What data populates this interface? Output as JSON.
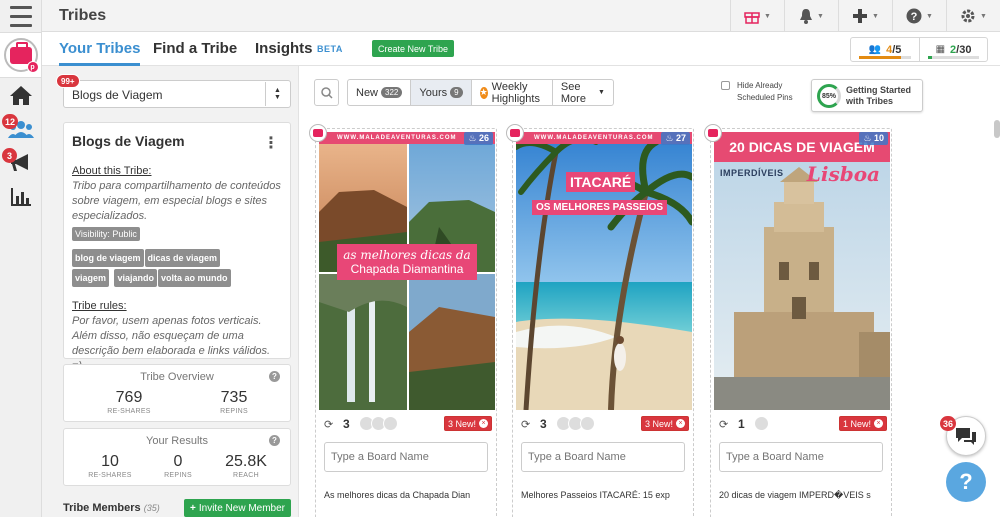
{
  "app": {
    "title": "Tribes",
    "colors": {
      "accent": "#3b8fd0",
      "brand": "#e5245e",
      "green": "#2ea44f",
      "badge": "#d9363e"
    }
  },
  "rail": {
    "logo_icon": "tailwind-logo-icon",
    "items": [
      {
        "icon": "home-icon"
      },
      {
        "icon": "tribes-icon",
        "badge": "12"
      },
      {
        "icon": "megaphone-icon",
        "badge": "3"
      },
      {
        "icon": "chart-icon"
      }
    ]
  },
  "tabs": {
    "your_tribes": "Your Tribes",
    "find_tribe": "Find a Tribe",
    "insights": "Insights",
    "beta": "BETA",
    "create": "Create New Tribe"
  },
  "counters": {
    "tribes": {
      "used": "4",
      "total": "/5",
      "fraction": 0.8
    },
    "boards": {
      "used": "2",
      "total": "/30",
      "fraction": 0.07
    }
  },
  "board_select": {
    "badge": "99+",
    "value": "Blogs de Viagem"
  },
  "tribe": {
    "name": "Blogs de Viagem",
    "about_heading": "About this Tribe:",
    "about_text": "Tribo para compartilhamento de conteúdos sobre viagem, em especial blogs e sites especializados.",
    "visibility": "Visibility: Public",
    "tags": [
      "blog de viagem",
      "dicas de viagem",
      "viagem",
      "viajando",
      "volta ao mundo"
    ],
    "rules_heading": "Tribe rules:",
    "rules_text": "Por favor, usem apenas fotos verticais. Além disso, não esqueçam de uma descrição bem elaborada e links válidos. =)"
  },
  "overview": {
    "title": "Tribe Overview",
    "reshares": "769",
    "reshares_label": "RE-SHARES",
    "repins": "735",
    "repins_label": "REPINS"
  },
  "results": {
    "title": "Your Results",
    "reshares": "10",
    "reshares_label": "RE-SHARES",
    "repins": "0",
    "repins_label": "REPINS",
    "reach": "25.8K",
    "reach_label": "REACH"
  },
  "members": {
    "title": "Tribe Members",
    "count": "(35)",
    "invite": "Invite New Member"
  },
  "filters": {
    "new_label": "New",
    "new_count": "322",
    "yours_label": "Yours",
    "yours_count": "9",
    "weekly": "Weekly Highlights",
    "see_more": "See More",
    "hide_line1": "Hide Already",
    "hide_line2": "Scheduled Pins",
    "getting_percent": "85%",
    "getting_percent_value": 85,
    "getting_line1": "Getting Started",
    "getting_line2": "with Tribes"
  },
  "pins": [
    {
      "repins": "26",
      "reshares": "3",
      "new_badge": "3 New!",
      "url_text": "WWW.MALADEAVENTURAS.COM",
      "overlay_script": "as melhores dicas da",
      "overlay_main": "Chapada Diamantina",
      "board_placeholder": "Type a Board Name",
      "description": "As melhores dicas da Chapada Dian"
    },
    {
      "repins": "27",
      "reshares": "3",
      "new_badge": "3 New!",
      "url_text": "WWW.MALADEAVENTURAS.COM",
      "overlay_title": "ITACARÉ",
      "overlay_sub": "OS MELHORES PASSEIOS",
      "board_placeholder": "Type a Board Name",
      "description": "Melhores Passeios ITACARÉ: 15 exp"
    },
    {
      "repins": "10",
      "reshares": "1",
      "new_badge": "1 New!",
      "overlay_title": "20 DICAS DE VIAGEM",
      "overlay_sub": "IMPERDÍVEIS",
      "overlay_city": "Lisboa",
      "board_placeholder": "Type a Board Name",
      "description": "20 dicas de viagem IMPERD�VEIS s"
    }
  ],
  "widgets": {
    "chat_badge": "36",
    "help": "?"
  }
}
